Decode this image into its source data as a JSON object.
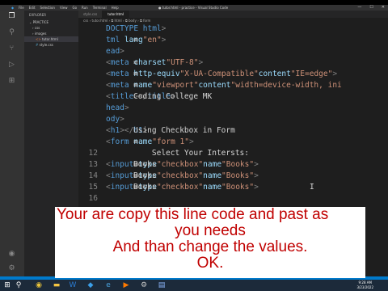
{
  "window": {
    "title": "● tutor.html - practice - Visual Studio Code",
    "menu": [
      "File",
      "Edit",
      "Selection",
      "View",
      "Go",
      "Run",
      "Terminal",
      "Help"
    ],
    "controls": [
      "—",
      "☐",
      "✕"
    ]
  },
  "activity_bar": {
    "icons": [
      "files-icon",
      "search-icon",
      "source-control-icon",
      "run-debug-icon",
      "extensions-icon"
    ],
    "bottom_icons": [
      "account-icon",
      "settings-gear-icon"
    ]
  },
  "sidebar": {
    "header": "EXPLORER",
    "section": "PRACTICE",
    "items": [
      {
        "label": "› css",
        "indent": 1
      },
      {
        "label": "› images",
        "indent": 1
      },
      {
        "label": "tutor.html",
        "indent": 2,
        "selected": true
      },
      {
        "label": "style.css",
        "indent": 2
      }
    ]
  },
  "tabs": [
    {
      "label": "style.css",
      "active": false
    },
    {
      "label": "tutor.html",
      "active": true
    }
  ],
  "breadcrumb": "css › tutor.html › ⧉ html › ⧉ body › ⧉ form",
  "code_lines": [
    {
      "n": "",
      "tokens": [
        [
          "tag",
          "DOCTYPE html"
        ],
        [
          "punc",
          ">"
        ]
      ]
    },
    {
      "n": "",
      "tokens": [
        [
          "tag",
          "tml "
        ],
        [
          "attr",
          "lang"
        ],
        [
          "txt",
          "="
        ],
        [
          "str",
          "\"en\""
        ],
        [
          "punc",
          ">"
        ]
      ]
    },
    {
      "n": "",
      "tokens": [
        [
          "tag",
          "ead"
        ],
        [
          "punc",
          ">"
        ]
      ]
    },
    {
      "n": "",
      "tokens": [
        [
          "txt",
          "  "
        ],
        [
          "punc",
          "<"
        ],
        [
          "tag",
          "meta "
        ],
        [
          "attr",
          "charset"
        ],
        [
          "txt",
          "="
        ],
        [
          "str",
          "\"UTF-8\""
        ],
        [
          "punc",
          ">"
        ]
      ]
    },
    {
      "n": "",
      "tokens": [
        [
          "txt",
          "  "
        ],
        [
          "punc",
          "<"
        ],
        [
          "tag",
          "meta "
        ],
        [
          "attr",
          "http-equiv"
        ],
        [
          "txt",
          "="
        ],
        [
          "str",
          "\"X-UA-Compatible\""
        ],
        [
          "txt",
          " "
        ],
        [
          "attr",
          "content"
        ],
        [
          "txt",
          "="
        ],
        [
          "str",
          "\"IE=edge\""
        ],
        [
          "punc",
          ">"
        ]
      ]
    },
    {
      "n": "",
      "tokens": [
        [
          "txt",
          "  "
        ],
        [
          "punc",
          "<"
        ],
        [
          "tag",
          "meta "
        ],
        [
          "attr",
          "name"
        ],
        [
          "txt",
          "="
        ],
        [
          "str",
          "\"viewport\""
        ],
        [
          "txt",
          " "
        ],
        [
          "attr",
          "content"
        ],
        [
          "txt",
          "="
        ],
        [
          "str",
          "\"width=device-width, ini"
        ]
      ]
    },
    {
      "n": "",
      "tokens": [
        [
          "txt",
          "  "
        ],
        [
          "punc",
          "<"
        ],
        [
          "tag",
          "title"
        ],
        [
          "punc",
          ">"
        ],
        [
          "txt",
          "Coding College MK"
        ],
        [
          "punc",
          "</"
        ],
        [
          "tag",
          "title"
        ],
        [
          "punc",
          ">"
        ]
      ]
    },
    {
      "n": "",
      "tokens": [
        [
          "tag",
          "head"
        ],
        [
          "punc",
          ">"
        ]
      ]
    },
    {
      "n": "",
      "tokens": [
        [
          "tag",
          "ody"
        ],
        [
          "punc",
          ">"
        ]
      ]
    },
    {
      "n": "",
      "tokens": [
        [
          "txt",
          "  "
        ],
        [
          "punc",
          "<"
        ],
        [
          "tag",
          "h1"
        ],
        [
          "punc",
          ">"
        ],
        [
          "txt",
          "Using Checkbox in Form"
        ],
        [
          "punc",
          "</"
        ],
        [
          "tag",
          "h1"
        ],
        [
          "punc",
          ">"
        ]
      ]
    },
    {
      "n": "",
      "tokens": [
        [
          "txt",
          "  "
        ],
        [
          "punc",
          "<"
        ],
        [
          "tag",
          "form "
        ],
        [
          "attr",
          "name"
        ],
        [
          "txt",
          "="
        ],
        [
          "str",
          "\"form 1\""
        ],
        [
          "punc",
          ">"
        ]
      ]
    },
    {
      "n": "12",
      "tokens": [
        [
          "txt",
          "    Select Your Intersts:"
        ]
      ]
    },
    {
      "n": "13",
      "tokens": [
        [
          "txt",
          "      "
        ],
        [
          "punc",
          "<"
        ],
        [
          "tag",
          "input "
        ],
        [
          "attr",
          "type"
        ],
        [
          "txt",
          "="
        ],
        [
          "str",
          "\"checkbox\""
        ],
        [
          "txt",
          " "
        ],
        [
          "attr",
          "name"
        ],
        [
          "txt",
          "="
        ],
        [
          "str",
          "\"Books\""
        ],
        [
          "punc",
          ">"
        ],
        [
          "txt",
          "Books"
        ]
      ]
    },
    {
      "n": "14",
      "tokens": [
        [
          "txt",
          "      "
        ],
        [
          "punc",
          "<"
        ],
        [
          "tag",
          "input "
        ],
        [
          "attr",
          "type"
        ],
        [
          "txt",
          "="
        ],
        [
          "str",
          "\"checkbox\""
        ],
        [
          "txt",
          " "
        ],
        [
          "attr",
          "name"
        ],
        [
          "txt",
          "="
        ],
        [
          "str",
          "\"Books\""
        ],
        [
          "punc",
          ">"
        ],
        [
          "txt",
          "Books"
        ]
      ]
    },
    {
      "n": "15",
      "tokens": [
        [
          "txt",
          "      "
        ],
        [
          "punc",
          "<"
        ],
        [
          "tag",
          "input "
        ],
        [
          "attr",
          "type"
        ],
        [
          "txt",
          "="
        ],
        [
          "str",
          "\"checkbox\""
        ],
        [
          "txt",
          " "
        ],
        [
          "attr",
          "name"
        ],
        [
          "txt",
          "="
        ],
        [
          "str",
          "\"Books\""
        ],
        [
          "punc",
          ">"
        ],
        [
          "txt",
          "Books"
        ]
      ]
    },
    {
      "n": "16",
      "tokens": []
    }
  ],
  "cursor_glyph": "I",
  "overlay": {
    "lines": [
      "Your are copy this line code and past as",
      "you needs",
      "And than change the values.",
      "OK."
    ],
    "color": "#c00000"
  },
  "taskbar": {
    "icons": [
      "start-icon",
      "search-icon",
      "chrome-icon",
      "explorer-icon",
      "word-icon",
      "vscode-icon",
      "edge-icon",
      "media-icon",
      "settings-icon",
      "notepad-icon"
    ],
    "time": "9:28 AM",
    "date": "3/23/2022"
  },
  "colors": {
    "editor_bg": "#1e1e1e",
    "tag": "#569cd6",
    "attribute": "#9cdcfe",
    "string": "#ce9178",
    "status_bar": "#007acc"
  }
}
